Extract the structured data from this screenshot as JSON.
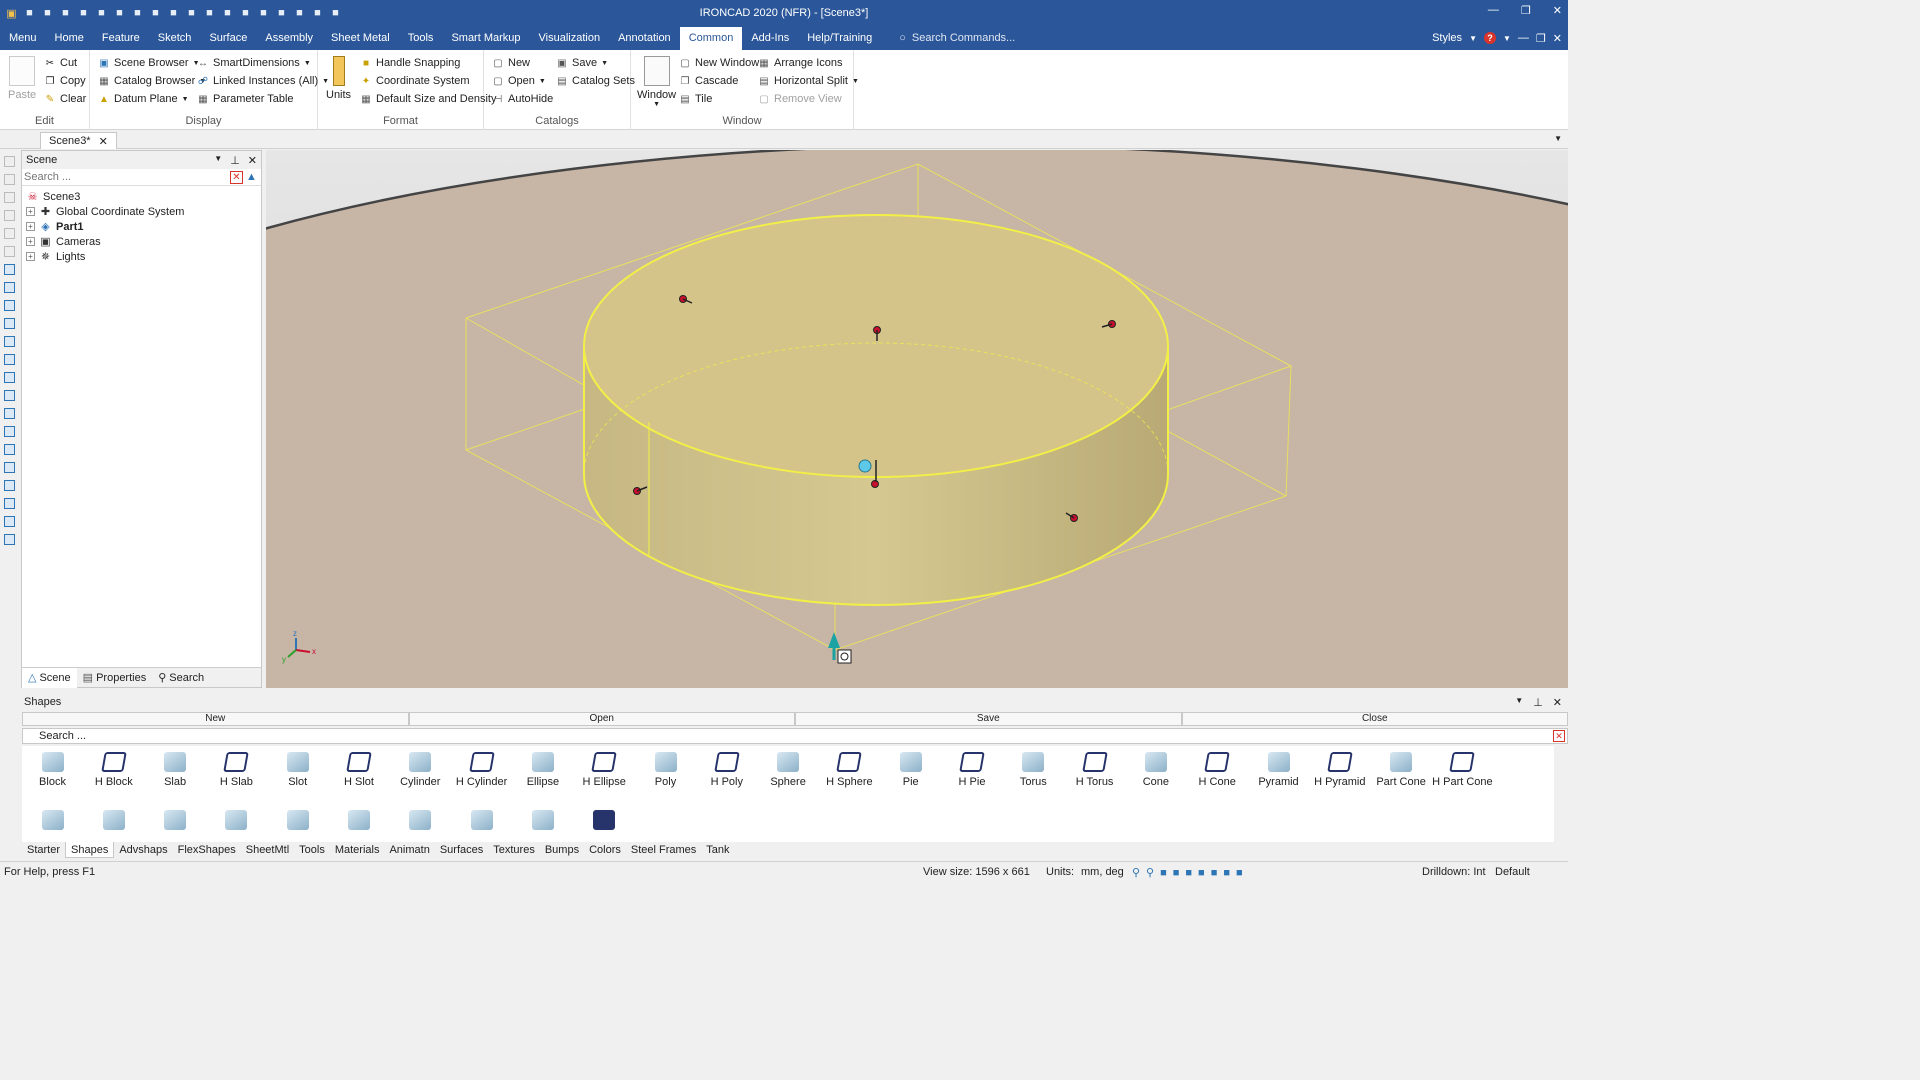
{
  "app": {
    "title": "IRONCAD 2020 (NFR) - [Scene3*]"
  },
  "quick_access": [
    "app-logo-icon",
    "new-icon",
    "email-icon",
    "pdf-icon",
    "print-icon",
    "print-preview-icon",
    "open-folder-icon",
    "save-icon",
    "save-all-icon",
    "cut-icon",
    "copy-icon",
    "paste-icon",
    "undo-icon",
    "redo-icon",
    "globe-icon",
    "filter-icon",
    "panel-icon",
    "window-icon",
    "more-icon"
  ],
  "menu": {
    "tabs": [
      "Menu",
      "Home",
      "Feature",
      "Sketch",
      "Surface",
      "Assembly",
      "Sheet Metal",
      "Tools",
      "Smart Markup",
      "Visualization",
      "Annotation",
      "Common",
      "Add-Ins",
      "Help/Training"
    ],
    "active_tab": "Common",
    "search_placeholder": "Search Commands...",
    "styles_label": "Styles"
  },
  "ribbon": {
    "edit": {
      "label": "Edit",
      "paste": "Paste",
      "cut": "Cut",
      "copy": "Copy",
      "clear": "Clear"
    },
    "display": {
      "label": "Display",
      "scene_browser": "Scene Browser",
      "catalog_browser": "Catalog Browser",
      "datum_plane": "Datum Plane",
      "smart_dimensions": "SmartDimensions",
      "linked_instances": "Linked Instances (All)",
      "parameter_table": "Parameter Table"
    },
    "format": {
      "label": "Format",
      "units": "Units",
      "handle_snapping": "Handle Snapping",
      "coordinate_system": "Coordinate System",
      "default_size_density": "Default Size and Density"
    },
    "catalogs": {
      "label": "Catalogs",
      "new": "New",
      "open": "Open",
      "autohide": "AutoHide",
      "save": "Save",
      "catalog_sets": "Catalog Sets"
    },
    "window": {
      "label": "Window",
      "window": "Window",
      "new_window": "New Window",
      "cascade": "Cascade",
      "tile": "Tile",
      "arrange_icons": "Arrange Icons",
      "horizontal_split": "Horizontal Split",
      "remove_view": "Remove View"
    }
  },
  "document_tab": {
    "name": "Scene3*"
  },
  "scene_panel": {
    "title": "Scene",
    "search_placeholder": "Search ...",
    "tree": [
      {
        "label": "Scene3",
        "icon": "scene-icon",
        "bold": false,
        "expandable": false
      },
      {
        "label": "Global Coordinate System",
        "icon": "axes-icon",
        "bold": false,
        "expandable": true
      },
      {
        "label": "Part1",
        "icon": "part-icon",
        "bold": true,
        "expandable": true
      },
      {
        "label": "Cameras",
        "icon": "camera-icon",
        "bold": false,
        "expandable": true
      },
      {
        "label": "Lights",
        "icon": "light-icon",
        "bold": false,
        "expandable": true
      }
    ],
    "tabs": [
      "Scene",
      "Properties",
      "Search"
    ]
  },
  "viewport": {
    "triad": {
      "x": "x",
      "y": "y",
      "z": "z"
    }
  },
  "shapes_panel": {
    "title": "Shapes",
    "bar": [
      "New",
      "Open",
      "Save",
      "Close"
    ],
    "search_placeholder": "Search ...",
    "items": [
      {
        "label": "Block",
        "hollow": false
      },
      {
        "label": "H Block",
        "hollow": true
      },
      {
        "label": "Slab",
        "hollow": false
      },
      {
        "label": "H Slab",
        "hollow": true
      },
      {
        "label": "Slot",
        "hollow": false
      },
      {
        "label": "H Slot",
        "hollow": true
      },
      {
        "label": "Cylinder",
        "hollow": false
      },
      {
        "label": "H Cylinder",
        "hollow": true
      },
      {
        "label": "Ellipse",
        "hollow": false
      },
      {
        "label": "H Ellipse",
        "hollow": true
      },
      {
        "label": "Poly",
        "hollow": false
      },
      {
        "label": "H Poly",
        "hollow": true
      },
      {
        "label": "Sphere",
        "hollow": false
      },
      {
        "label": "H Sphere",
        "hollow": true
      },
      {
        "label": "Pie",
        "hollow": false
      },
      {
        "label": "H Pie",
        "hollow": true
      },
      {
        "label": "Torus",
        "hollow": false
      },
      {
        "label": "H Torus",
        "hollow": true
      },
      {
        "label": "Cone",
        "hollow": false
      },
      {
        "label": "H Cone",
        "hollow": true
      },
      {
        "label": "Pyramid",
        "hollow": false
      },
      {
        "label": "H Pyramid",
        "hollow": true
      },
      {
        "label": "Part Cone",
        "hollow": false
      },
      {
        "label": "H Part Cone",
        "hollow": true
      }
    ],
    "row2_count": 10,
    "categories": [
      "Starter",
      "Shapes",
      "Advshaps",
      "FlexShapes",
      "SheetMtl",
      "Tools",
      "Materials",
      "Animatn",
      "Surfaces",
      "Textures",
      "Bumps",
      "Colors",
      "Steel Frames",
      "Tank"
    ],
    "active_category": "Shapes"
  },
  "status": {
    "help": "For Help, press F1",
    "view_size": "View size: 1596 x  661",
    "units_label": "Units:",
    "units_value": "mm, deg",
    "drilldown": "Drilldown: Int",
    "style": "Default"
  },
  "colors": {
    "title_blue": "#2b579a",
    "ground": "#c7b5a6",
    "cylinder": "#d4c48a",
    "highlight": "#f2f046"
  }
}
